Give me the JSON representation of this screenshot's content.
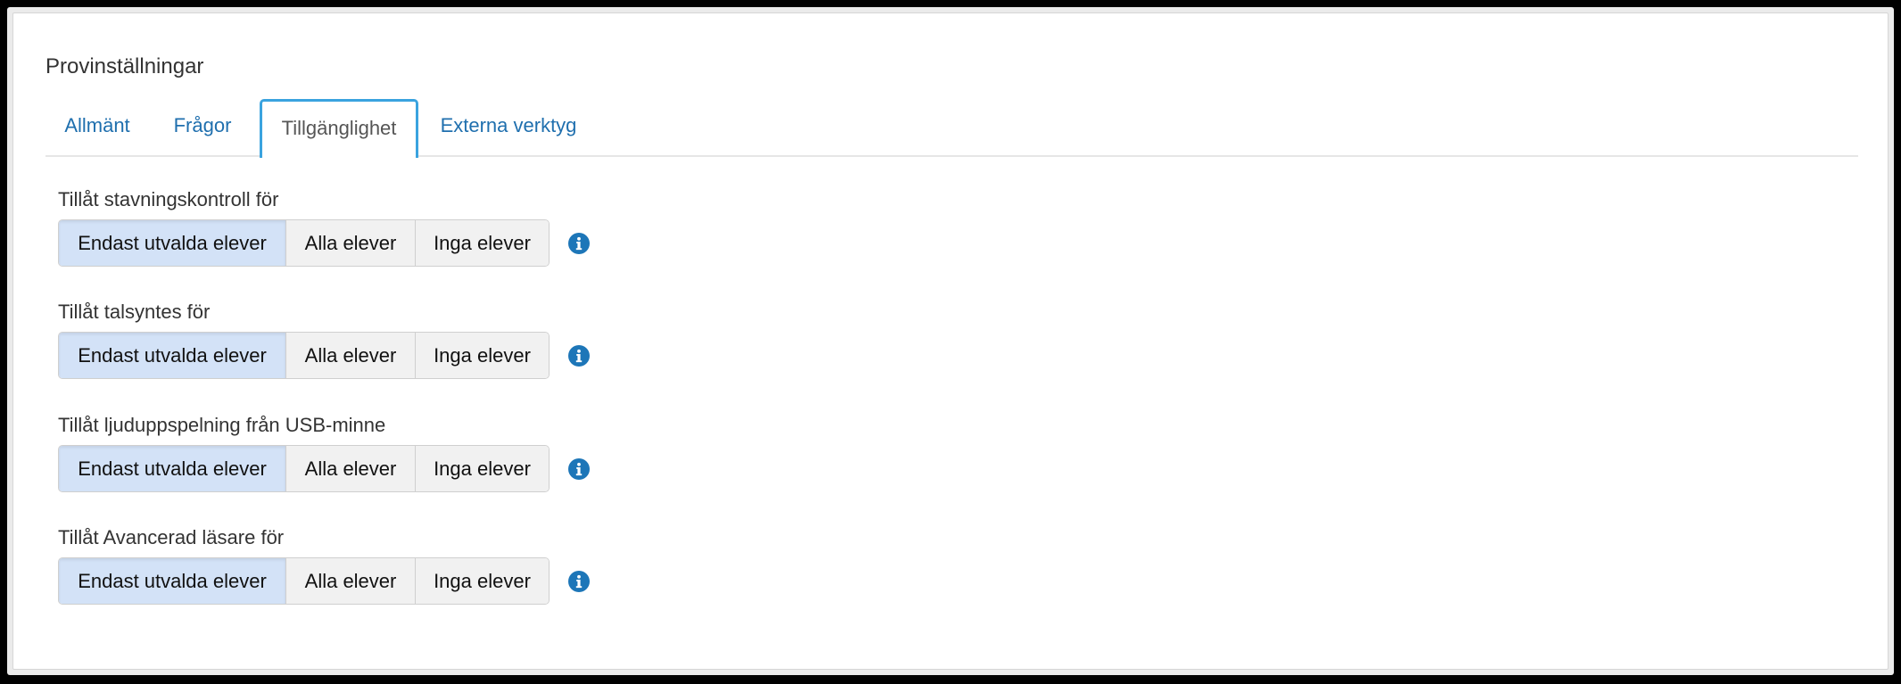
{
  "panel": {
    "title": "Provinställningar"
  },
  "tabs": [
    {
      "label": "Allmänt"
    },
    {
      "label": "Frågor"
    },
    {
      "label": "Tillgänglighet"
    },
    {
      "label": "Externa verktyg"
    }
  ],
  "active_tab": "Tillgänglighet",
  "settings": [
    {
      "label": "Tillåt stavningskontroll för",
      "options": [
        "Endast utvalda elever",
        "Alla elever",
        "Inga elever"
      ],
      "selected": "Endast utvalda elever",
      "info_icon": "info-icon"
    },
    {
      "label": "Tillåt talsyntes för",
      "options": [
        "Endast utvalda elever",
        "Alla elever",
        "Inga elever"
      ],
      "selected": "Endast utvalda elever",
      "info_icon": "info-icon"
    },
    {
      "label": "Tillåt ljuduppspelning från USB-minne",
      "options": [
        "Endast utvalda elever",
        "Alla elever",
        "Inga elever"
      ],
      "selected": "Endast utvalda elever",
      "info_icon": "info-icon"
    },
    {
      "label": "Tillåt Avancerad läsare för",
      "options": [
        "Endast utvalda elever",
        "Alla elever",
        "Inga elever"
      ],
      "selected": "Endast utvalda elever",
      "info_icon": "info-icon"
    }
  ],
  "colors": {
    "tab_link": "#1f6fae",
    "active_tab_border": "#3aa3df",
    "selected_segment": "#d3e2f7",
    "info_icon": "#1d76b8"
  }
}
